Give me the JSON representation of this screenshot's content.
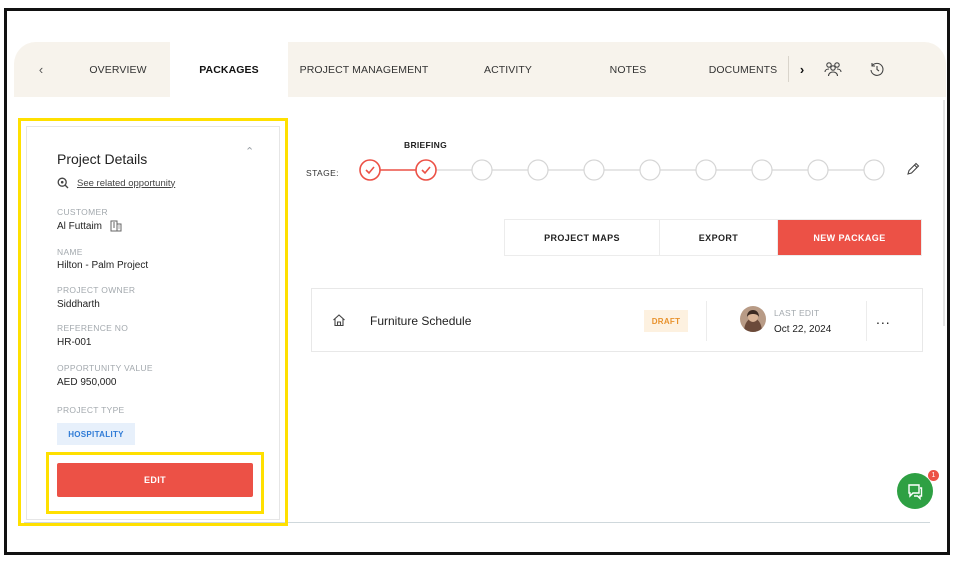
{
  "tabs": {
    "items": [
      {
        "label": "OVERVIEW"
      },
      {
        "label": "PACKAGES"
      },
      {
        "label": "PROJECT MANAGEMENT"
      },
      {
        "label": "ACTIVITY"
      },
      {
        "label": "NOTES"
      },
      {
        "label": "DOCUMENTS"
      }
    ],
    "active": "PACKAGES",
    "prev_icon": "chevron-left-icon",
    "next_icon": "chevron-right-icon",
    "team_icon": "team-icon",
    "history_icon": "history-icon"
  },
  "project_details": {
    "title": "Project Details",
    "related_link": "See related opportunity",
    "fields": {
      "customer_label": "CUSTOMER",
      "customer_value": "Al Futtaim",
      "name_label": "NAME",
      "name_value": "Hilton - Palm Project",
      "owner_label": "PROJECT OWNER",
      "owner_value": "Siddharth",
      "reference_label": "REFERENCE NO",
      "reference_value": "HR-001",
      "opportunity_label": "OPPORTUNITY VALUE",
      "opportunity_value": "AED 950,000",
      "type_label": "PROJECT TYPE",
      "type_value": "HOSPITALITY"
    },
    "edit_label": "EDIT"
  },
  "stage": {
    "label": "STAGE:",
    "current_name": "BRIEFING",
    "total_steps": 10,
    "completed_steps": 2
  },
  "actions": {
    "project_maps": "PROJECT MAPS",
    "export": "EXPORT",
    "new_package": "NEW PACKAGE"
  },
  "packages": [
    {
      "name": "Furniture Schedule",
      "status": "DRAFT",
      "last_edit_label": "LAST EDIT",
      "last_edit_date": "Oct 22, 2024",
      "more": "..."
    }
  ],
  "chat": {
    "badge": "1"
  },
  "colors": {
    "accent": "#ec5146",
    "tabbar_bg": "#f7f3ec",
    "highlight": "#ffe000",
    "draft_bg": "#fdf1e0",
    "draft_text": "#e8922d",
    "hospitality_bg": "#e7f0fb",
    "hospitality_text": "#2f7bd6",
    "chat": "#2ea043"
  }
}
